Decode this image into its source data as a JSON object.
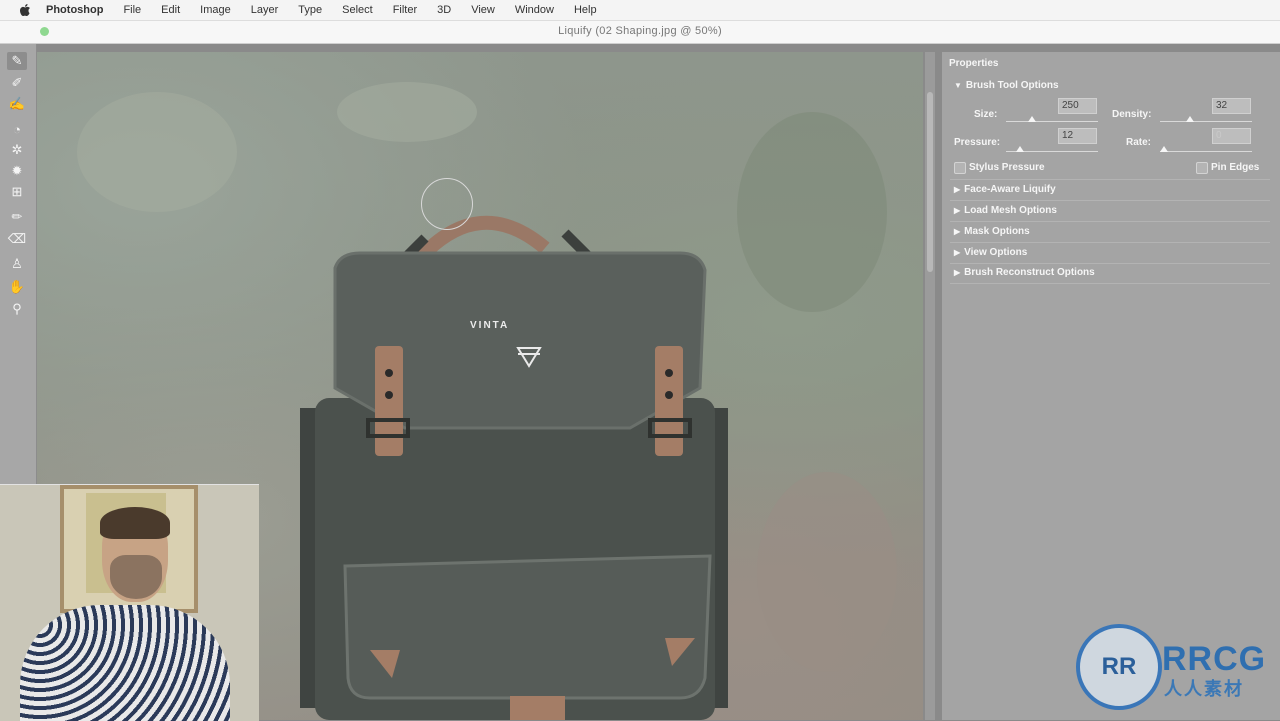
{
  "menubar": {
    "app": "Photoshop",
    "items": [
      "File",
      "Edit",
      "Image",
      "Layer",
      "Type",
      "Select",
      "Filter",
      "3D",
      "View",
      "Window",
      "Help"
    ]
  },
  "window": {
    "title": "Liquify (02 Shaping.jpg @ 50%)"
  },
  "tools": [
    {
      "icon": "forward-warp-tool-icon"
    },
    {
      "icon": "reconstruct-tool-icon"
    },
    {
      "icon": "smooth-tool-icon"
    },
    {
      "icon": "twirl-clockwise-tool-icon"
    },
    {
      "icon": "pucker-tool-icon"
    },
    {
      "icon": "bloat-tool-icon"
    },
    {
      "icon": "push-left-tool-icon"
    },
    {
      "icon": "freeze-mask-tool-icon"
    },
    {
      "icon": "thaw-mask-tool-icon"
    },
    {
      "icon": "face-tool-icon"
    },
    {
      "icon": "hand-tool-icon"
    },
    {
      "icon": "zoom-tool-icon"
    }
  ],
  "canvas": {
    "brand_text": "VINTA"
  },
  "panel": {
    "header": "Properties",
    "brush_options": {
      "title": "Brush Tool Options",
      "size_label": "Size:",
      "size_value": "250",
      "density_label": "Density:",
      "density_value": "32",
      "pressure_label": "Pressure:",
      "pressure_value": "12",
      "rate_label": "Rate:",
      "rate_value": "0",
      "stylus_label": "Stylus Pressure",
      "pin_edges_label": "Pin Edges"
    },
    "sections": [
      "Face-Aware Liquify",
      "Load Mesh Options",
      "Mask Options",
      "View Options",
      "Brush Reconstruct Options"
    ]
  },
  "watermark": {
    "logo_text": "RRCG",
    "logo_subtext": "人人素材",
    "logo_mark": "RR"
  }
}
